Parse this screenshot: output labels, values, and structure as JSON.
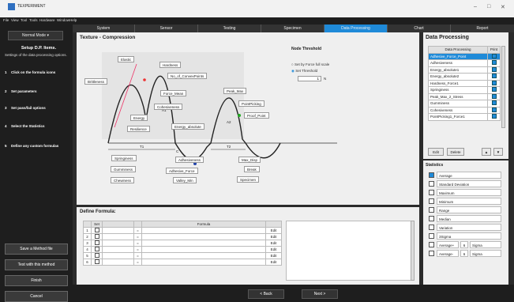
{
  "window": {
    "title": "TEXPERIMENT",
    "min": "–",
    "max": "□",
    "close": "✕"
  },
  "menu": [
    "File",
    "View",
    "Tool",
    "Tools",
    "Hardware",
    "Window",
    "Help"
  ],
  "tabs": [
    {
      "label": "System"
    },
    {
      "label": "Sensor"
    },
    {
      "label": "Testing"
    },
    {
      "label": "Specimen"
    },
    {
      "label": "Data Processing"
    },
    {
      "label": "Chart"
    },
    {
      "label": "Report"
    }
  ],
  "sidebar": {
    "mode": "Normal Mode",
    "title": "Setup D.P. Items.",
    "subtitle": "Settings of the data processing options.",
    "steps": [
      {
        "num": "1",
        "label": "Click on the formula icons"
      },
      {
        "num": "2",
        "label": "Set parameters"
      },
      {
        "num": "3",
        "label": "Set pass/fail options"
      },
      {
        "num": "4",
        "label": "Select the Statistics"
      },
      {
        "num": "5",
        "label": "Define any custom formulas"
      }
    ],
    "buttons": {
      "save": "Save a Method file",
      "test": "Test with this method",
      "finish": "Finish",
      "cancel": "Cancel"
    }
  },
  "main": {
    "title": "Texture - Compression",
    "node_threshold": {
      "title": "Node Threshold",
      "option1": "Set by Force full scale",
      "option2": "Set Threshold",
      "value": "1",
      "unit": "N"
    },
    "nodes": {
      "elastic": "Elastic",
      "hardness": "Hardness",
      "brittleness": "Brittleness",
      "no_convex": "No_of_ConvexPoints",
      "force_mean": "Force_Mean",
      "peak_max": "Peak_Max",
      "energy": "Energy",
      "cohesiveness": "Cohesiveness",
      "point_picking": "PointPicking",
      "resilience": "Resilience",
      "energy_absolute": "Energy_absolute",
      "proof_point": "Proof_Point",
      "springiness": "Springiness",
      "adhesiveness": "Adhesiveness",
      "max_disp": "Max_Disp",
      "gumminess": "Gumminess",
      "adhesive_force": "Adhesive_Force",
      "break": "Break",
      "chewiness": "Chewiness",
      "valley_min": "Valley_Min",
      "specimen": "Specimen"
    },
    "labels": {
      "a1": "A1",
      "a2": "A2",
      "t1": "T1",
      "t2": "T2",
      "c": "C"
    }
  },
  "data_processing": {
    "title": "Data Processing",
    "col_name": "Data Processing",
    "col_print": "Print",
    "rows": [
      "Adhesive_Force_Point",
      "Adhesiveness",
      "Energy_absolute1",
      "Energy_absolute2",
      "Hardness_Force1",
      "Springiness",
      "Peak_Max_2_Stress",
      "Gumminess",
      "Cohesiveness",
      "PointPicking1_Force1"
    ],
    "edit": "Edit",
    "delete": "Delete",
    "up": "▲",
    "down": "▼"
  },
  "statistics": {
    "title": "Statistics",
    "items": [
      "Average",
      "Standard Deviation",
      "Maximum",
      "Minimum",
      "Range",
      "Median",
      "Variation",
      "3Sigma"
    ],
    "avg_plus": {
      "label": "Average+",
      "n": "6",
      "sigma": "Sigma"
    },
    "avg_minus": {
      "label": "Average-",
      "n": "6",
      "sigma": "Sigma"
    }
  },
  "formula": {
    "title": "Define Formula:",
    "col_set": "Set",
    "col_formula": "Formula",
    "rows": [
      "1",
      "2",
      "3",
      "4",
      "5",
      "6"
    ],
    "eq": "=",
    "edit": "Edit"
  },
  "nav": {
    "back": "< Back",
    "next": "Next >"
  }
}
